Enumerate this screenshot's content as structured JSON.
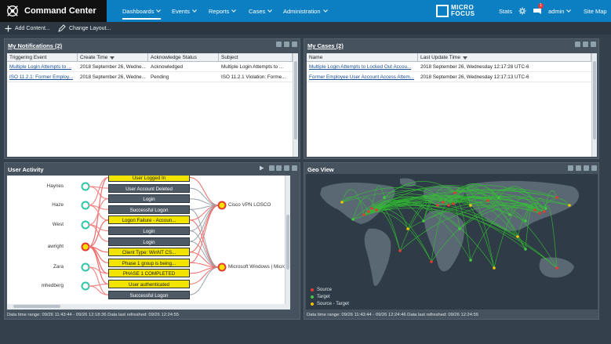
{
  "nav": {
    "app_title": "Command Center",
    "menus": [
      {
        "label": "Dashboards",
        "active": true
      },
      {
        "label": "Events"
      },
      {
        "label": "Reports"
      },
      {
        "label": "Cases"
      },
      {
        "label": "Administration"
      }
    ],
    "logo_text_1": "MICRO",
    "logo_text_2": "FOCUS",
    "stats": "Stats",
    "badge": "1",
    "user": "admin",
    "site_map": "Site Map"
  },
  "toolbar": {
    "add_content": "Add Content...",
    "change_layout": "Change Layout..."
  },
  "notifications": {
    "title": "My Notifications (2)",
    "columns": [
      "Triggering Event",
      "Create Time",
      "Acknowledge Status",
      "Subject"
    ],
    "rows": [
      [
        "Multiple Login Attempts to ...",
        "2018 September 26, Wedne...",
        "Acknowledged",
        "Multiple Login Attempts to ..."
      ],
      [
        "ISO 11.2.1: Former Employ...",
        "2018 September 26, Wedne...",
        "Pending",
        "ISO 11.2.1 Violation: Forme..."
      ]
    ]
  },
  "cases": {
    "title": "My Cases (2)",
    "columns": [
      "Name",
      "Last Update Time"
    ],
    "rows": [
      [
        "Multiple Login Attempts to Locked Out Accou...",
        "2018 September 26, Wednesday 12:17:28 UTC-6"
      ],
      [
        "Former Employee User Account Access Attem...",
        "2018 September 26, Wednesday 12:17:13 UTC-6"
      ]
    ]
  },
  "user_activity": {
    "title": "User Activity",
    "users": [
      "Haynes",
      "Haze",
      "West",
      "awright",
      "Zara",
      "mhedberg"
    ],
    "events": [
      {
        "label": "User Logged In",
        "highlight": true
      },
      {
        "label": "User Account Deleted",
        "highlight": false
      },
      {
        "label": "Login",
        "highlight": false
      },
      {
        "label": "Successful Logon",
        "highlight": false
      },
      {
        "label": "Logon Failure - Accoun...",
        "highlight": true
      },
      {
        "label": "Login",
        "highlight": false
      },
      {
        "label": "Login",
        "highlight": false
      },
      {
        "label": "Client Type: WinNT CS...",
        "highlight": true
      },
      {
        "label": "Phase 1 group is being...",
        "highlight": true
      },
      {
        "label": "PHASE 1 COMPLETED",
        "highlight": true
      },
      {
        "label": "User authenticated",
        "highlight": true
      },
      {
        "label": "Successful Logon",
        "highlight": false
      }
    ],
    "targets": [
      "Cisco VPN LOSCO",
      "Microsoft Windows | Micro"
    ],
    "footer": "Data time range: 09/26 11:43:44 - 09/26 12:18:36 Data last refreshed: 09/26 12:24:55"
  },
  "geo_view": {
    "title": "Geo View",
    "legend": [
      {
        "label": "Source",
        "color": "#e53935"
      },
      {
        "label": "Target",
        "color": "#43c743"
      },
      {
        "label": "Source - Target",
        "color": "#f0c400"
      }
    ],
    "footer": "Data time range: 09/26 11:43:44 - 09/26 12:24:46 Data last refreshed: 09/26 12:24:55"
  }
}
